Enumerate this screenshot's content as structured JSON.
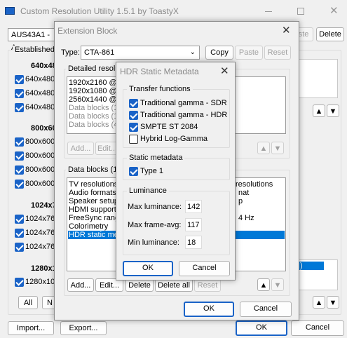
{
  "main": {
    "title": "Custom Resolution Utility 1.5.1 by ToastyX",
    "monitor": "AUS43A1 - A",
    "paste_label": "aste",
    "delete_label": "Delete",
    "established_label": "Established",
    "groups": [
      {
        "header": "640x48",
        "items": [
          "640x480",
          "640x480",
          "640x480"
        ]
      },
      {
        "header": "800x60",
        "items": [
          "800x600",
          "800x600",
          "800x600",
          "800x600"
        ]
      },
      {
        "header": "1024x7",
        "items": [
          "1024x76",
          "1024x76",
          "1024x76"
        ]
      },
      {
        "header": "1280x1",
        "items": [
          "1280x10"
        ]
      }
    ],
    "all_label": "All",
    "none_label": "N",
    "import_label": "Import...",
    "export_label": "Export...",
    "ok_label": "OK",
    "cancel_label": "Cancel"
  },
  "ext": {
    "title": "Extension Block",
    "type_label": "Type:",
    "type_value": "CTA-861",
    "copy_label": "Copy",
    "paste_label": "Paste",
    "reset_label": "Reset",
    "detailed_label": "Detailed resolu",
    "detailed_items": [
      "1920x2160 @",
      "1920x1080 @",
      "2560x1440 @",
      "Data blocks (1",
      "Data blocks (1",
      "Data blocks (4"
    ],
    "add_label": "Add...",
    "edit_label": "Edit...",
    "data_blocks_label": "Data blocks (1",
    "data_block_items": [
      "TV resolutions",
      "Audio formats",
      "Speaker setup",
      "HDMI support",
      "FreeSync rang",
      "Colorimetry",
      "HDR static me"
    ],
    "right_items": [
      "resolutions",
      "nat",
      "p",
      "4 Hz"
    ],
    "delete_label": "Delete",
    "delete_all_label": "Delete all",
    "reset2_label": "Reset",
    "ok_label": "OK",
    "cancel_label": "Cancel",
    "right_list_char": "I)"
  },
  "hdr": {
    "title": "HDR Static Metadata",
    "transfer_label": "Transfer functions",
    "transfer_items": [
      {
        "label": "Traditional gamma - SDR",
        "checked": true
      },
      {
        "label": "Traditional gamma - HDR",
        "checked": true
      },
      {
        "label": "SMPTE ST 2084",
        "checked": true
      },
      {
        "label": "Hybrid Log-Gamma",
        "checked": false
      }
    ],
    "static_label": "Static metadata",
    "type1_label": "Type 1",
    "luminance_label": "Luminance",
    "max_lum_label": "Max luminance:",
    "max_lum_value": "142",
    "max_frame_label": "Max frame-avg:",
    "max_frame_value": "117",
    "min_lum_label": "Min luminance:",
    "min_lum_value": "18",
    "ok_label": "OK",
    "cancel_label": "Cancel"
  }
}
